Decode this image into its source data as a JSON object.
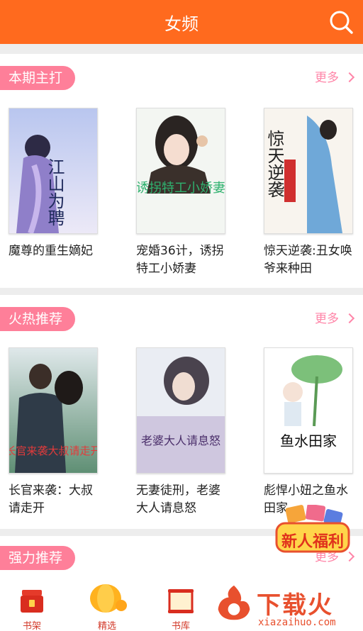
{
  "header": {
    "title": "女频",
    "search_icon": "search-icon"
  },
  "sections": [
    {
      "title": "本期主打",
      "more_label": "更多",
      "books": [
        {
          "name": "魔尊的重生嫡妃",
          "cover_text": "江山为聘"
        },
        {
          "name": "宠婚36计，诱拐特工小娇妻",
          "cover_text": "诱拐特工小娇妻"
        },
        {
          "name": "惊天逆袭:丑女唤爷来种田",
          "cover_text": "惊天逆袭"
        }
      ]
    },
    {
      "title": "火热推荐",
      "more_label": "更多",
      "books": [
        {
          "name": "长官来袭：大叔请走开",
          "cover_text": "长官来袭大叔请走开"
        },
        {
          "name": "无妻徒刑，老婆大人请息怒",
          "cover_text": "老婆大人请息怒"
        },
        {
          "name": "彪悍小妞之鱼水田家",
          "cover_text": "鱼水田家"
        }
      ]
    },
    {
      "title": "强力推荐",
      "more_label": "更多"
    }
  ],
  "promo": {
    "label": "新人福利"
  },
  "tabs": [
    {
      "label": "书架",
      "icon": "bookshelf-icon"
    },
    {
      "label": "精选",
      "icon": "lantern-icon"
    },
    {
      "label": "书库",
      "icon": "scroll-icon"
    }
  ],
  "watermark": {
    "brand": "下载火",
    "url": "xiazaihuo.com"
  },
  "colors": {
    "header": "#ff6a1e",
    "pill": "#fe7f99",
    "more": "#ff85a8",
    "tab_label": "#d23a2a"
  }
}
